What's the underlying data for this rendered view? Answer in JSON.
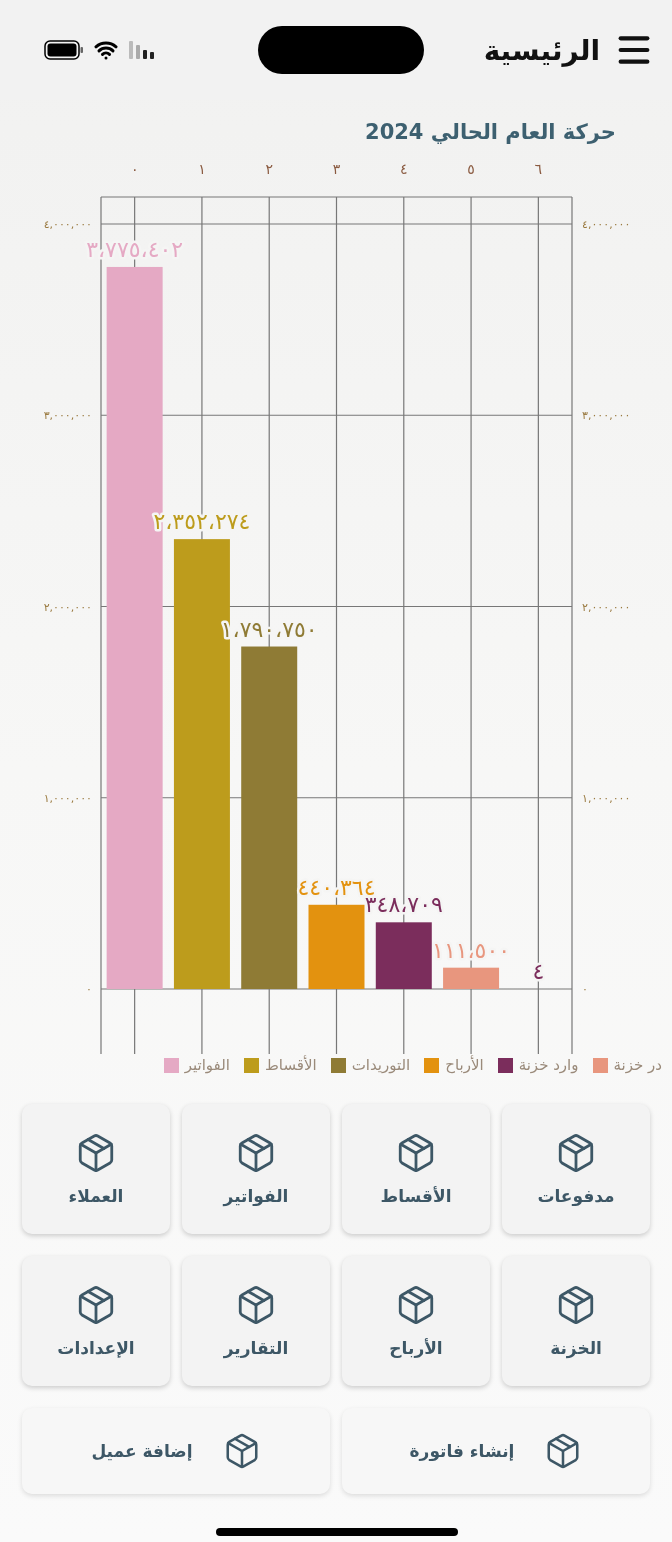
{
  "header": {
    "title": "الرئيسية"
  },
  "chart": {
    "chart_data": {
      "type": "bar",
      "title": "حركة العام الحالي 2024",
      "categories": [
        "٠",
        "١",
        "٢",
        "٣",
        "٤",
        "٥",
        "٦"
      ],
      "ylim": [
        0,
        4000000
      ],
      "grid": true,
      "legend": true,
      "yticks": [
        {
          "value": 0,
          "label": "٠"
        },
        {
          "value": 1000000,
          "label": "١,٠٠٠,٠٠٠"
        },
        {
          "value": 2000000,
          "label": "٢,٠٠٠,٠٠٠"
        },
        {
          "value": 3000000,
          "label": "٣,٠٠٠,٠٠٠"
        },
        {
          "value": 4000000,
          "label": "٤,٠٠٠,٠٠٠"
        }
      ],
      "series": [
        {
          "name": "الفواتير",
          "color": "#e5a9c4",
          "values": [
            3775402,
            null,
            null,
            null,
            null,
            null,
            null
          ]
        },
        {
          "name": "الأقساط",
          "color": "#bd9c1c",
          "values": [
            null,
            2352274,
            null,
            null,
            null,
            null,
            null
          ]
        },
        {
          "name": "التوريدات",
          "color": "#8f7b35",
          "values": [
            null,
            null,
            1790750,
            null,
            null,
            null,
            null
          ]
        },
        {
          "name": "الأرباح",
          "color": "#e3920f",
          "values": [
            null,
            null,
            null,
            440364,
            null,
            null,
            null
          ]
        },
        {
          "name": "وارد خزنة",
          "color": "#7b2d5c",
          "values": [
            null,
            null,
            null,
            null,
            348709,
            null,
            4
          ]
        },
        {
          "name": "در خزنة",
          "color": "#e8967e",
          "values": [
            null,
            null,
            null,
            null,
            null,
            111500,
            null
          ]
        }
      ],
      "value_labels": [
        "٣،٧٧٥،٤٠٢",
        "٢،٣٥٢،٢٧٤",
        "١،٧٩٠،٧٥٠",
        "٤٤٠،٣٦٤",
        "٣٤٨،٧٠٩",
        "١١١،٥٠٠",
        "٤"
      ]
    }
  },
  "tiles": [
    {
      "label": "مدفوعات"
    },
    {
      "label": "الأقساط"
    },
    {
      "label": "الفواتير"
    },
    {
      "label": "العملاء"
    },
    {
      "label": "الخزنة"
    },
    {
      "label": "الأرباح"
    },
    {
      "label": "التقارير"
    },
    {
      "label": "الإعدادات"
    }
  ],
  "actions": [
    {
      "label": "إنشاء فاتورة"
    },
    {
      "label": "إضافة عميل"
    }
  ]
}
